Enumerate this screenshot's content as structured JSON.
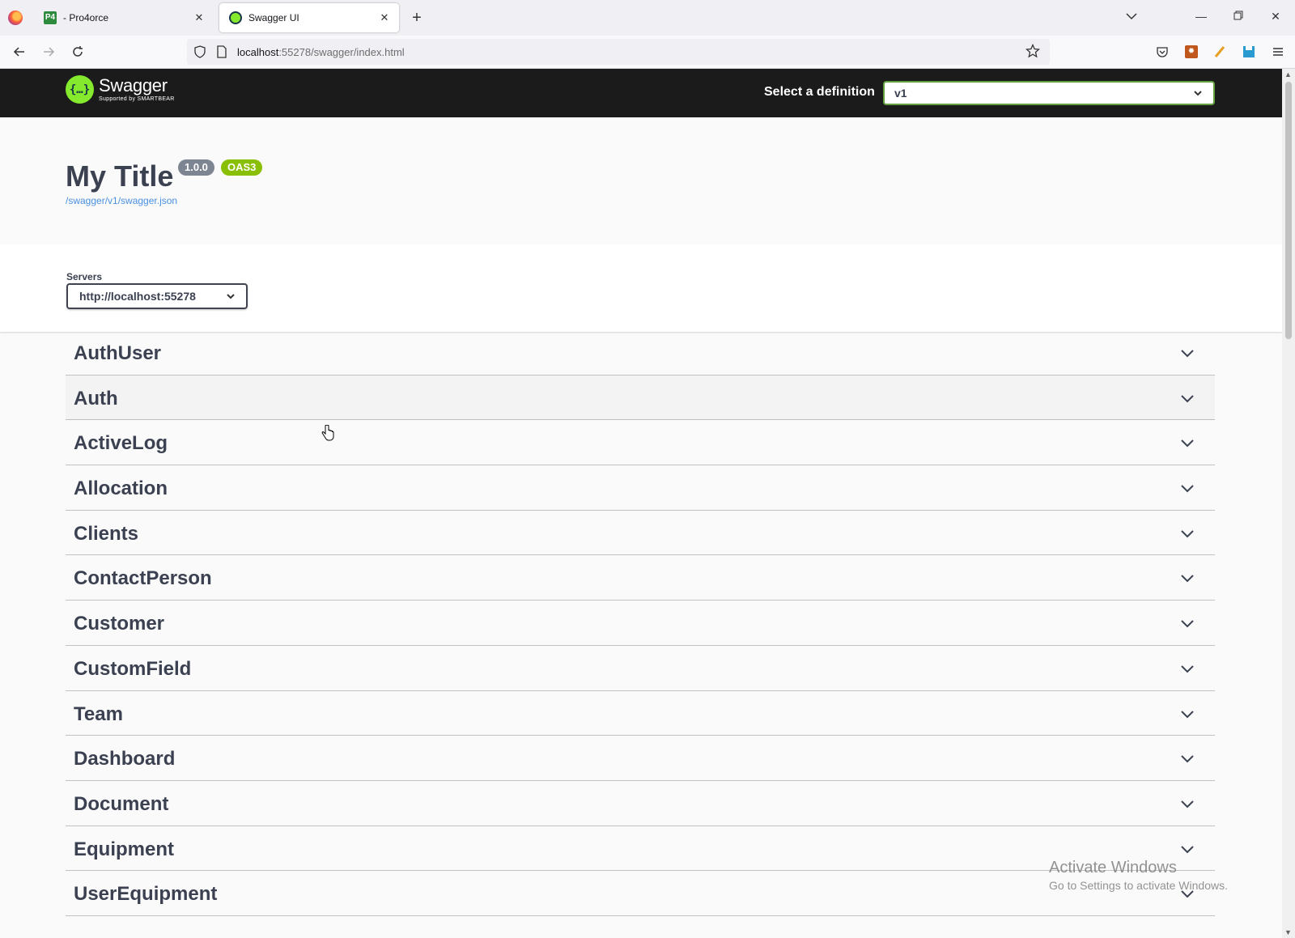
{
  "browser": {
    "tabs": [
      {
        "title": "- Pro4orce",
        "favicon": "P4",
        "active": false
      },
      {
        "title": "Swagger UI",
        "favicon": "swagger-icon",
        "active": true
      }
    ],
    "url": {
      "host": "localhost",
      "rest": ":55278/swagger/index.html"
    }
  },
  "swagger": {
    "logo_text": "Swagger",
    "logo_sub": "Supported by SMARTBEAR",
    "definition_label": "Select a definition",
    "definition_value": "v1",
    "title": "My Title",
    "version": "1.0.0",
    "oas_badge": "OAS3",
    "spec_url": "/swagger/v1/swagger.json",
    "servers_label": "Servers",
    "server_value": "http://localhost:55278",
    "tags": [
      {
        "name": "AuthUser"
      },
      {
        "name": "Auth"
      },
      {
        "name": "ActiveLog"
      },
      {
        "name": "Allocation"
      },
      {
        "name": "Clients"
      },
      {
        "name": "ContactPerson"
      },
      {
        "name": "Customer"
      },
      {
        "name": "CustomField"
      },
      {
        "name": "Team"
      },
      {
        "name": "Dashboard"
      },
      {
        "name": "Document"
      },
      {
        "name": "Equipment"
      },
      {
        "name": "UserEquipment"
      }
    ],
    "colors": {
      "accent": "#85ea2d",
      "version_badge": "#7d8492",
      "oas_badge": "#89bf04",
      "topbar": "#1b1b1b"
    }
  },
  "watermark": {
    "line1": "Activate Windows",
    "line2": "Go to Settings to activate Windows."
  }
}
